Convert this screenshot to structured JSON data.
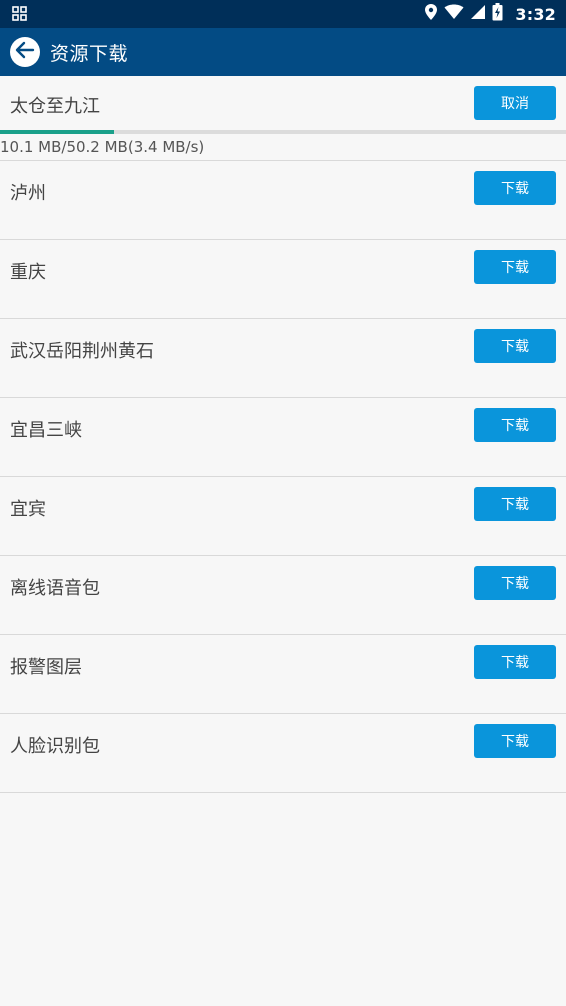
{
  "status_bar": {
    "time": "3:32",
    "icons": [
      "grid-icon",
      "location-icon",
      "wifi-icon",
      "signal-icon",
      "battery-icon"
    ]
  },
  "app_bar": {
    "title": "资源下载",
    "back_icon": "back-arrow-icon"
  },
  "active_download": {
    "name": "太仓至九江",
    "button_label": "取消",
    "progress_text": "10.1 MB/50.2 MB(3.4 MB/s)",
    "progress_fraction": 0.201
  },
  "items": [
    {
      "name": "泸州",
      "button_label": "下载"
    },
    {
      "name": "重庆",
      "button_label": "下载"
    },
    {
      "name": "武汉岳阳荆州黄石",
      "button_label": "下载"
    },
    {
      "name": "宜昌三峡",
      "button_label": "下载"
    },
    {
      "name": "宜宾",
      "button_label": "下载"
    },
    {
      "name": "离线语音包",
      "button_label": "下载"
    },
    {
      "name": "报警图层",
      "button_label": "下载"
    },
    {
      "name": "人脸识别包",
      "button_label": "下载"
    }
  ],
  "colors": {
    "status_bar": "#002f59",
    "app_bar": "#034b84",
    "button": "#0a95db",
    "progress": "#1aa08a"
  }
}
